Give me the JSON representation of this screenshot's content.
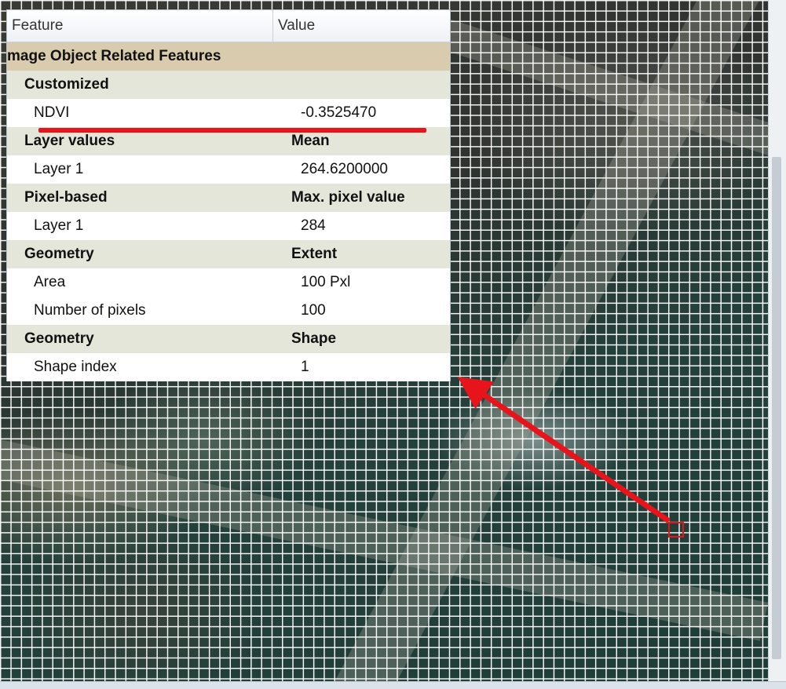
{
  "table": {
    "columns": [
      "Feature",
      "Value"
    ],
    "rows": [
      {
        "kind": "cat",
        "feature": "mage Object Related Features",
        "value": ""
      },
      {
        "kind": "group",
        "feature": "Customized",
        "value": ""
      },
      {
        "kind": "item",
        "feature": "NDVI",
        "value": "-0.3525470"
      },
      {
        "kind": "group",
        "feature": "Layer values",
        "value": "Mean"
      },
      {
        "kind": "item",
        "feature": "Layer 1",
        "value": "264.6200000"
      },
      {
        "kind": "group",
        "feature": "Pixel-based",
        "value": "Max. pixel value"
      },
      {
        "kind": "item",
        "feature": "Layer 1",
        "value": "284"
      },
      {
        "kind": "group",
        "feature": "Geometry",
        "value": "Extent"
      },
      {
        "kind": "item",
        "feature": "Area",
        "value": "100 Pxl"
      },
      {
        "kind": "item",
        "feature": "Number of pixels",
        "value": "100"
      },
      {
        "kind": "group",
        "feature": "Geometry",
        "value": "Shape"
      },
      {
        "kind": "item",
        "feature": "Shape index",
        "value": "1"
      }
    ]
  },
  "colors": {
    "annotation_red": "#e8141c",
    "grid_lines": "#ffffff",
    "category_row": "#d9ccae",
    "group_row": "#e5e6da"
  },
  "icons": {
    "selection": "selected-pixel-box-icon",
    "pointer": "red-arrow-icon"
  }
}
